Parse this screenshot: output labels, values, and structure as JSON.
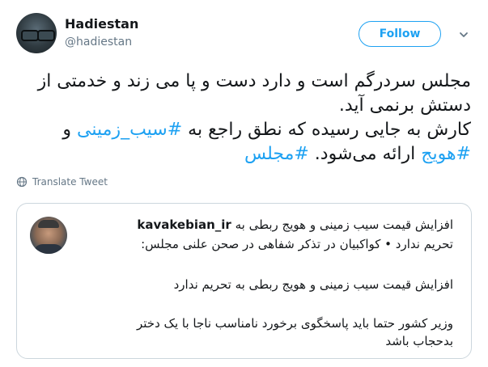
{
  "author": {
    "display_name": "Hadiestan",
    "handle": "@hadiestan"
  },
  "actions": {
    "follow_label": "Follow"
  },
  "tweet": {
    "line1": "مجلس سردرگم است و دارد دست و پا می زند و خدمتی از",
    "line2": "دستش برنمی آید.",
    "line3_text": "کارش به جایی رسیده که نطق راجع به ",
    "line3_tag": "#سیب_زمینی",
    "line3_tail": " و",
    "line4_tag1": "#هویج",
    "line4_text": " ارائه می‌شود. ",
    "line4_tag2": "#مجلس"
  },
  "translate_label": "Translate Tweet",
  "quoted": {
    "prefix": "افزایش قیمت سیب زمینی و هویج ربطی به ",
    "name": "kavakebian_ir",
    "line2": "تحریم ندارد • کواکبیان در تذکر شفاهی در صحن علنی مجلس:",
    "line3": "افزایش قیمت سیب زمینی و هویج ربطی به تحریم ندارد",
    "line4": "وزیر کشور حتما باید پاسخگوی برخورد نامناسب ناجا با یک دختر",
    "line5": "بدحجاب باشد"
  },
  "colors": {
    "accent": "#1da1f2",
    "text": "#14171a",
    "muted": "#657786",
    "border": "#ccd6dd"
  },
  "icons": {
    "caret": "chevron-down-icon",
    "translate": "globe-icon"
  }
}
